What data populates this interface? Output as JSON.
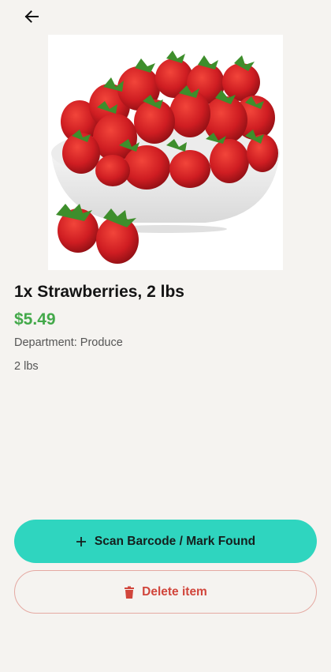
{
  "header": {
    "back_icon": "arrow-left-icon"
  },
  "product": {
    "image_alt": "strawberries-in-bowl",
    "title": "1x Strawberries, 2 lbs",
    "price": "$5.49",
    "department_label": "Department:",
    "department_value": "Produce",
    "size": "2 lbs"
  },
  "actions": {
    "scan_label": "Scan Barcode / Mark Found",
    "scan_icon": "plus-icon",
    "delete_label": "Delete item",
    "delete_icon": "trash-icon"
  },
  "colors": {
    "background": "#f5f3f0",
    "price": "#43a94a",
    "primary_button": "#2fd5bf",
    "delete_text": "#d1453b",
    "delete_border": "#e5a9a2"
  }
}
